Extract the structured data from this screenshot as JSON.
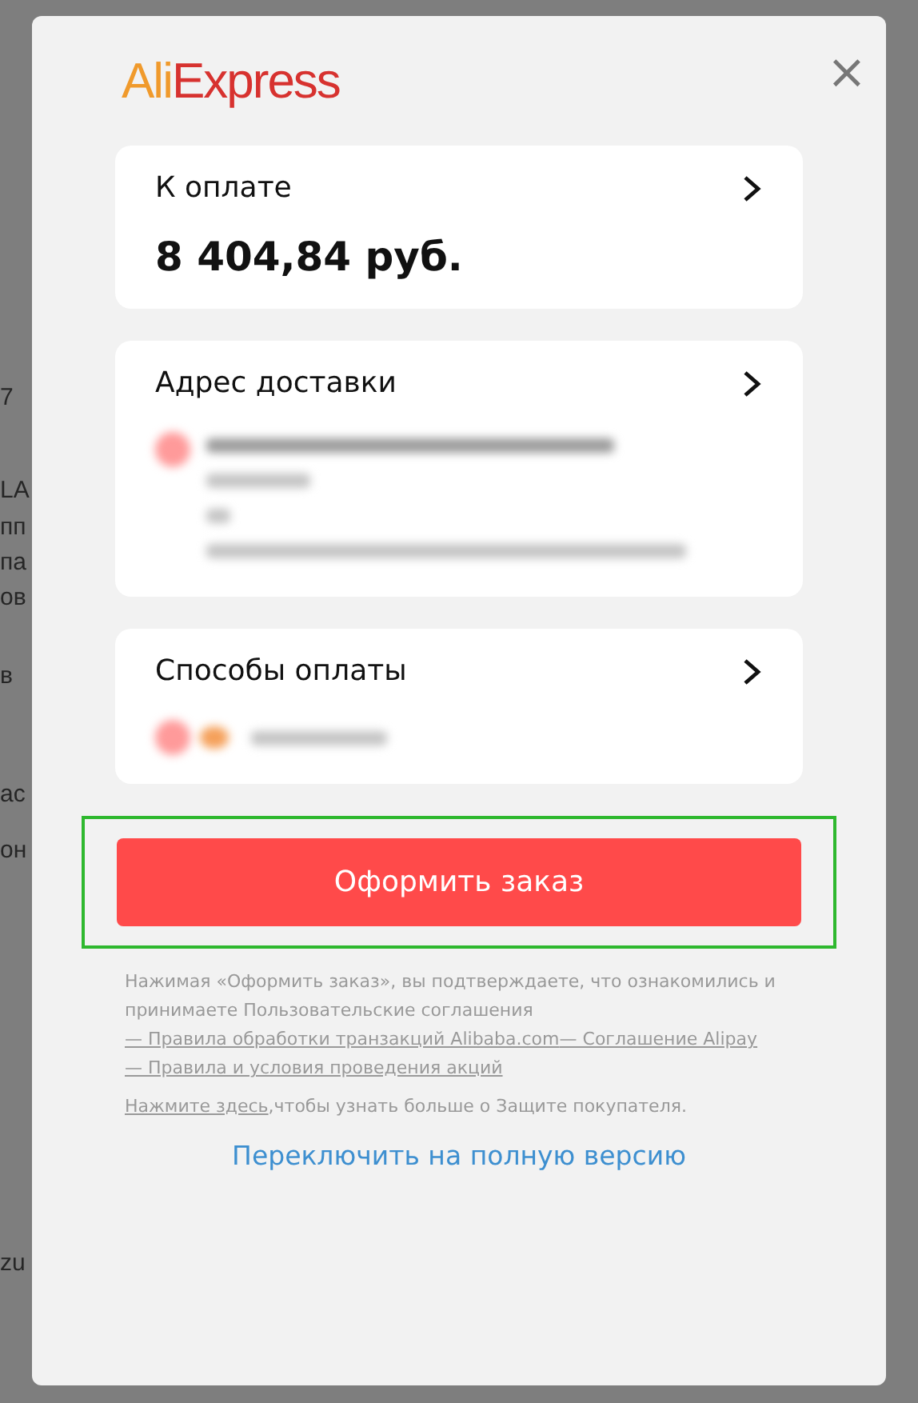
{
  "background_page": {
    "fragments": [
      "7",
      "LA",
      "пп",
      "па",
      "ов",
      "в",
      "ас",
      "он",
      "zu"
    ]
  },
  "logo": {
    "part_1": "Ali",
    "part_2": "Express"
  },
  "close": "×",
  "payment_due": {
    "title": "К оплате",
    "amount": "8 404,84 руб."
  },
  "delivery_address": {
    "title": "Адрес доставки"
  },
  "payment_methods": {
    "title": "Способы оплаты"
  },
  "order_button": {
    "label": "Оформить заказ",
    "highlighted": true
  },
  "legal": {
    "text": "Нажимая «Оформить заказ», вы подтверждаете, что ознакомились и принимаете Пользовательские соглашения",
    "links": [
      "— Правила обработки транзакций Alibaba.com",
      "— Соглашение Alipay",
      "— Правила и условия проведения акций"
    ]
  },
  "protection": {
    "link": "Нажмите здесь",
    "text": ",чтобы узнать больше о Защите покупателя."
  },
  "full_version_link": "Переключить на полную версию"
}
